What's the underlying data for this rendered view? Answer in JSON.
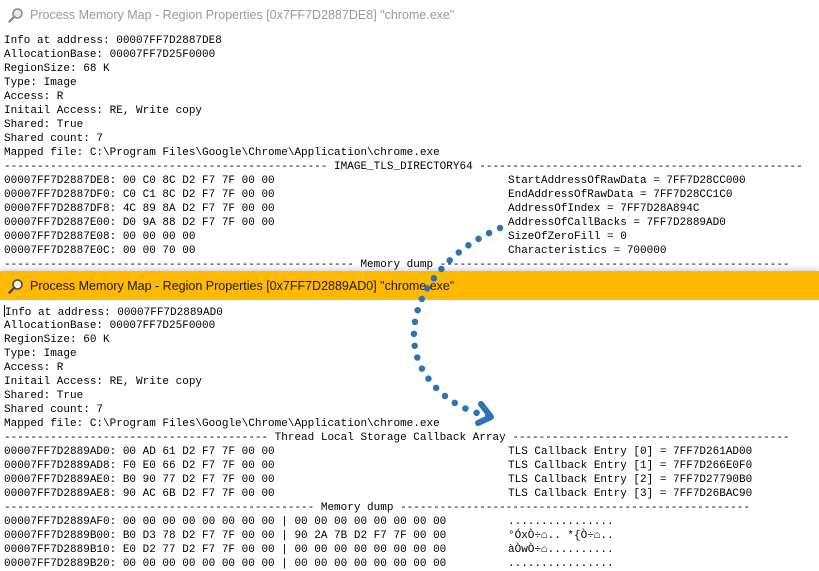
{
  "colors": {
    "accent_titlebar": "#ffb900",
    "arrow": "#2e74b5"
  },
  "window1": {
    "title": "Process Memory Map - Region Properties [0x7FF7D2887DE8] \"chrome.exe\"",
    "icon": "magnifier-icon",
    "info_lines": [
      "Info at address: 00007FF7D2887DE8",
      "AllocationBase: 00007FF7D25F0000",
      "RegionSize: 68 K",
      "Type: Image",
      "Access: R",
      "Initail Access: RE, Write copy",
      "Shared: True",
      "Shared count: 7",
      "Mapped file: C:\\Program Files\\Google\\Chrome\\Application\\chrome.exe"
    ],
    "section_header": "------------------------------------------------- IMAGE_TLS_DIRECTORY64 -------------------------------------------------",
    "rows": [
      {
        "hex": "00007FF7D2887DE8: 00 C0 8C D2 F7 7F 00 00",
        "field": "StartAddressOfRawData = 7FF7D28CC000"
      },
      {
        "hex": "00007FF7D2887DF0: C0 C1 8C D2 F7 7F 00 00",
        "field": "EndAddressOfRawData = 7FF7D28CC1C0"
      },
      {
        "hex": "00007FF7D2887DF8: 4C 89 8A D2 F7 7F 00 00",
        "field": "AddressOfIndex = 7FF7D28A894C"
      },
      {
        "hex": "00007FF7D2887E00: D0 9A 88 D2 F7 7F 00 00",
        "field": "AddressOfCallBacks = 7FF7D2889AD0"
      },
      {
        "hex": "00007FF7D2887E08: 00 00 00 00",
        "field": "SizeOfZeroFill = 0"
      },
      {
        "hex": "00007FF7D2887E0C: 00 00 70 00",
        "field": "Characteristics = 700000"
      }
    ],
    "dump_header": "----------------------------------------------------- Memory dump -----------------------------------------------------"
  },
  "window2": {
    "title": "Process Memory Map - Region Properties [0x7FF7D2889AD0] \"chrome.exe\"",
    "icon": "magnifier-icon",
    "info_lines": [
      "Info at address: 00007FF7D2889AD0",
      "AllocationBase: 00007FF7D25F0000",
      "RegionSize: 60 K",
      "Type: Image",
      "Access: R",
      "Initail Access: RE, Write copy",
      "Shared: True",
      "Shared count: 7",
      "Mapped file: C:\\Program Files\\Google\\Chrome\\Application\\chrome.exe"
    ],
    "section_header": "---------------------------------------- Thread Local Storage Callback Array ------------------------------------------",
    "rows": [
      {
        "hex": "00007FF7D2889AD0: 00 AD 61 D2 F7 7F 00 00",
        "field": "TLS Callback Entry [0] = 7FF7D261AD00"
      },
      {
        "hex": "00007FF7D2889AD8: F0 E0 66 D2 F7 7F 00 00",
        "field": "TLS Callback Entry [1] = 7FF7D266E0F0"
      },
      {
        "hex": "00007FF7D2889AE0: B0 90 77 D2 F7 7F 00 00",
        "field": "TLS Callback Entry [2] = 7FF7D27790B0"
      },
      {
        "hex": "00007FF7D2889AE8: 90 AC 6B D2 F7 7F 00 00",
        "field": "TLS Callback Entry [3] = 7FF7D26BAC90"
      }
    ],
    "dump_header": "----------------------------------------------- Memory dump -----------------------------------------------------",
    "dump_rows": [
      {
        "hex": "00007FF7D2889AF0: 00 00 00 00 00 00 00 00 | 00 00 00 00 00 00 00 00",
        "ascii": "................"
      },
      {
        "hex": "00007FF7D2889B00: B0 D3 78 D2 F7 7F 00 00 | 90 2A 7B D2 F7 7F 00 00",
        "ascii": "°ÓxÒ÷⌂.. *{Ò÷⌂.."
      },
      {
        "hex": "00007FF7D2889B10: E0 D2 77 D2 F7 7F 00 00 | 00 00 00 00 00 00 00 00",
        "ascii": "àÒwÒ÷⌂.........."
      },
      {
        "hex": "00007FF7D2889B20: 00 00 00 00 00 00 00 00 | 00 00 00 00 00 00 00 00",
        "ascii": "................"
      }
    ]
  }
}
